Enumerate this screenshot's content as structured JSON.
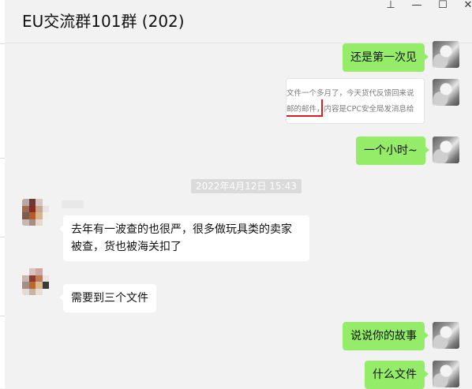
{
  "window": {
    "title": "EU交流群101群 (202)",
    "controls": {
      "pin": "⊥",
      "minimize": "—",
      "maximize": "☐",
      "close": "✕"
    }
  },
  "messages": [
    {
      "side": "right",
      "type": "text",
      "text": "还是第一次见"
    },
    {
      "side": "right",
      "type": "image",
      "lines": [
        "文件一个多月了，今天货代反馈回来说",
        "邮的邮件，内容是CPC安全局发消息给"
      ]
    },
    {
      "side": "right",
      "type": "text",
      "text": "一个小时~"
    },
    {
      "type": "timestamp",
      "text": "2022年4月12日 15:43"
    },
    {
      "side": "left",
      "type": "text",
      "text": "去年有一波查的也很严，很多做玩具类的卖家被查，货也被海关扣了"
    },
    {
      "side": "left",
      "type": "text",
      "text": "需要到三个文件"
    },
    {
      "side": "right",
      "type": "text",
      "text": "说说你的故事"
    },
    {
      "side": "right",
      "type": "text",
      "text": "什么文件"
    }
  ],
  "colors": {
    "bubble_self": "#95ec69",
    "bubble_other": "#ffffff",
    "background": "#f2f2f2"
  }
}
